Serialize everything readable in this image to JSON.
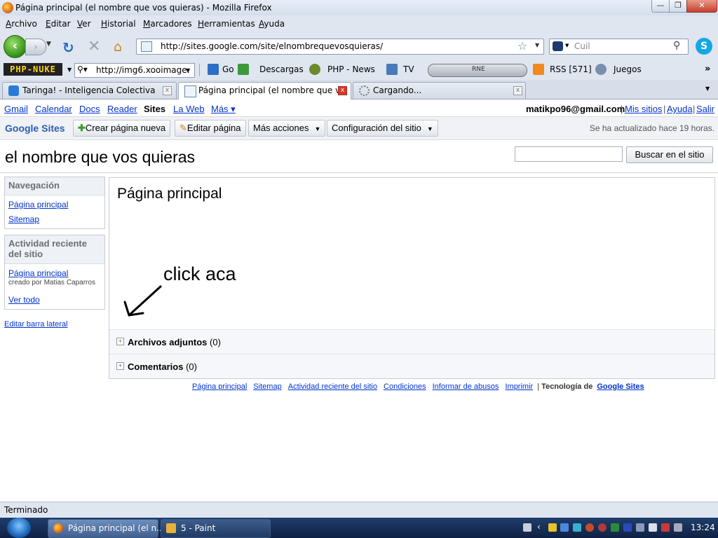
{
  "window": {
    "title": "Página principal (el nombre que vos quieras) - Mozilla Firefox",
    "buttons": {
      "minimize": "—",
      "maximize": "❐",
      "close": "✕"
    }
  },
  "menubar": [
    "Archivo",
    "Editar",
    "Ver",
    "Historial",
    "Marcadores",
    "Herramientas",
    "Ayuda"
  ],
  "nav": {
    "url": "http://sites.google.com/site/elnombrequevosquieras/",
    "search_placeholder": "Cuil"
  },
  "toolbar": {
    "logo_text": "PHP-NUKE",
    "search_value": "http://img6.xooimage.",
    "items": [
      "Go",
      "Descargas",
      "PHP - News",
      "TV",
      "RSS [571]",
      "Juegos"
    ],
    "radio_label": "RNE"
  },
  "tabs": [
    {
      "label": "Taringa! - Inteligencia Colectiva",
      "active": false
    },
    {
      "label": "Página principal (el nombre que v...",
      "active": true
    },
    {
      "label": "Cargando...",
      "active": false
    }
  ],
  "google_bar": {
    "links": [
      "Gmail",
      "Calendar",
      "Docs",
      "Reader",
      "Sites",
      "La Web",
      "Más ▾"
    ],
    "current": "Sites",
    "user": "matikpo96@gmail.com",
    "user_links": [
      "Mis sitios",
      "Ayuda",
      "Salir"
    ]
  },
  "sites_toolbar": {
    "logo": "Google Sites",
    "create_page": "Crear página nueva",
    "edit_page": "Editar página",
    "more_actions": "Más acciones",
    "site_settings": "Configuración del sitio",
    "updated": "Se ha actualizado hace 19 horas."
  },
  "site": {
    "title": "el nombre que vos quieras",
    "search_button": "Buscar en el sitio"
  },
  "sidebar": {
    "nav_title": "Navegación",
    "nav_items": [
      "Página principal",
      "Sitemap"
    ],
    "recent_title": "Actividad reciente del sitio",
    "recent_link": "Página principal",
    "recent_meta": "creado por Matias Caparros",
    "view_all": "Ver todo",
    "edit_sidebar": "Editar barra lateral"
  },
  "content": {
    "heading": "Página principal",
    "annotation": "click aca",
    "attachments": "Archivos adjuntos",
    "attachments_count": "(0)",
    "comments": "Comentarios",
    "comments_count": "(0)"
  },
  "footer": {
    "links": [
      "Página principal",
      "Sitemap",
      "Actividad reciente del sitio",
      "Condiciones",
      "Informar de abusos",
      "Imprimir"
    ],
    "powered_text": "Tecnología de",
    "powered_link": "Google Sites"
  },
  "status": "Terminado",
  "taskbar": {
    "tasks": [
      {
        "label": "Página principal (el n...",
        "active": true
      },
      {
        "label": "5 - Paint",
        "active": false
      }
    ],
    "clock": "13:24"
  }
}
